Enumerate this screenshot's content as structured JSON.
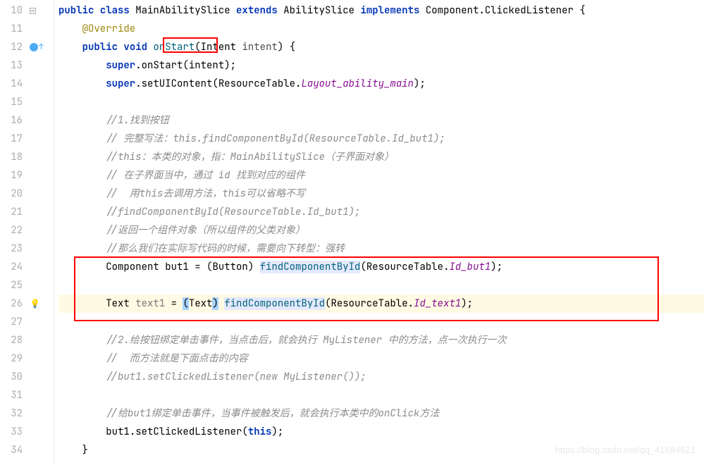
{
  "lines": {
    "start": 10,
    "end": 34
  },
  "code": {
    "l10": {
      "kw1": "public",
      "kw2": "class",
      "cls": "MainAbilitySlice",
      "kw3": "extends",
      "sup": "AbilitySlice",
      "kw4": "implements",
      "iface": "Component.ClickedListener",
      "brace": "{"
    },
    "l11": {
      "ann": "@Override"
    },
    "l12": {
      "kw1": "public",
      "kw2": "void",
      "method": "onStart",
      "paren": "(",
      "ptype": "Intent",
      "pname": "intent",
      "close": ") {"
    },
    "l13": {
      "supkw": "super",
      "dot": ".",
      "call": "onStart",
      "arg": "(intent);"
    },
    "l14": {
      "supkw": "super",
      "dot": ".",
      "call": "setUIContent",
      "open": "(",
      "cls": "ResourceTable",
      "dot2": ".",
      "field": "Layout_ability_main",
      "close": ");"
    },
    "l15": "",
    "l16": {
      "c": "//1.找到按钮"
    },
    "l17": {
      "c": "// 完整写法：this.findComponentById(ResourceTable.Id_but1);"
    },
    "l18": {
      "c": "//this：本类的对象，指：MainAbilitySlice（子界面对象）"
    },
    "l19": {
      "c": "// 在子界面当中，通过 id 找到对应的组件"
    },
    "l20": {
      "c": "//  用this去调用方法，this可以省略不写"
    },
    "l21": {
      "c": "//findComponentById(ResourceTable.Id_but1);"
    },
    "l22": {
      "c": "//返回一个组件对象（所以组件的父类对象）"
    },
    "l23": {
      "c": "//那么我们在实际写代码的时候，需要向下转型：强转"
    },
    "l24": {
      "type": "Component",
      "var": "but1",
      "eq": " = (",
      "cast": "Button",
      "close": ") ",
      "call": "findComponentById",
      "open": "(",
      "cls": "ResourceTable",
      "dot": ".",
      "field": "Id_but1",
      "end": ");"
    },
    "l25": "",
    "l26": {
      "type": "Text",
      "var": "text1",
      "eq": " = ",
      "castopen": "(",
      "cast": "Text",
      "castclose": ")",
      "sp": " ",
      "call": "findComponentById",
      "open": "(",
      "cls": "ResourceTable",
      "dot": ".",
      "field": "Id_text1",
      "end": ");"
    },
    "l27": "",
    "l28": {
      "c": "//2.给按钮绑定单击事件，当点击后，就会执行 MyListener 中的方法，点一次执行一次"
    },
    "l29": {
      "c": "//  而方法就是下面点击的内容"
    },
    "l30": {
      "c": "//but1.setClickedListener(new MyListener());"
    },
    "l31": "",
    "l32": {
      "c": "//给but1绑定单击事件，当事件被触发后，就会执行本类中的onClick方法"
    },
    "l33": {
      "var": "but1",
      "dot": ".",
      "call": "setClickedListener",
      "open": "(",
      "kw": "this",
      "close": ");"
    },
    "l34": {
      "brace": "}"
    }
  },
  "watermark": "https://blog.csdn.net/qq_41684621"
}
